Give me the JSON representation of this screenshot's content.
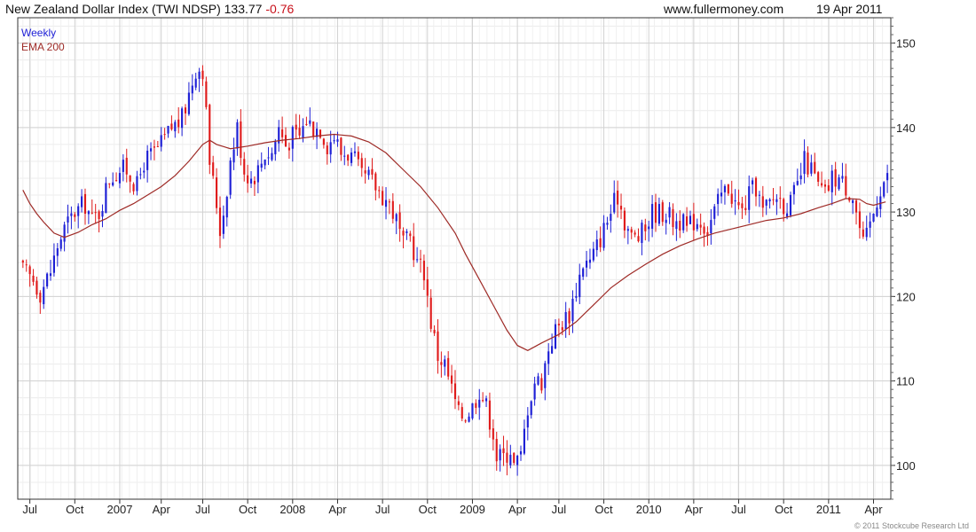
{
  "header": {
    "title": "New Zealand Dollar Index (TWI NDSP)",
    "last": "133.77",
    "change": "-0.76",
    "site": "www.fullermoney.com",
    "date": "19 Apr 2011"
  },
  "footer": {
    "copyright": "© 2011 Stockcube Research Ltd"
  },
  "colors": {
    "up": "#1d1fd6",
    "down": "#e01b1b",
    "ema": "#9e2a26",
    "grid": "#d2d2d2",
    "axis": "#333333"
  },
  "chart_data": {
    "type": "candlestick",
    "frequency": "Weekly",
    "legend": [
      "Weekly",
      "EMA 200"
    ],
    "ylim": [
      96,
      153
    ],
    "y_ticks": [
      100,
      110,
      120,
      130,
      140,
      150
    ],
    "x_ticks": [
      {
        "label": "Jul",
        "t": 2
      },
      {
        "label": "Oct",
        "t": 15
      },
      {
        "label": "2007",
        "t": 28
      },
      {
        "label": "Apr",
        "t": 40
      },
      {
        "label": "Jul",
        "t": 52
      },
      {
        "label": "Oct",
        "t": 65
      },
      {
        "label": "2008",
        "t": 78
      },
      {
        "label": "Apr",
        "t": 91
      },
      {
        "label": "Jul",
        "t": 104
      },
      {
        "label": "Oct",
        "t": 117
      },
      {
        "label": "2009",
        "t": 130
      },
      {
        "label": "Apr",
        "t": 143
      },
      {
        "label": "Jul",
        "t": 155
      },
      {
        "label": "Oct",
        "t": 168
      },
      {
        "label": "2010",
        "t": 181
      },
      {
        "label": "Apr",
        "t": 194
      },
      {
        "label": "Jul",
        "t": 207
      },
      {
        "label": "Oct",
        "t": 220
      },
      {
        "label": "2011",
        "t": 233
      },
      {
        "label": "Apr",
        "t": 246
      }
    ],
    "close_path": [
      [
        0,
        123
      ],
      [
        3,
        122
      ],
      [
        5,
        120.5
      ],
      [
        8,
        123
      ],
      [
        10,
        126
      ],
      [
        12,
        128
      ],
      [
        15,
        130
      ],
      [
        18,
        131
      ],
      [
        20,
        129
      ],
      [
        22,
        130
      ],
      [
        25,
        134
      ],
      [
        28,
        135
      ],
      [
        30,
        135
      ],
      [
        33,
        133
      ],
      [
        35,
        136
      ],
      [
        38,
        137
      ],
      [
        40,
        138
      ],
      [
        43,
        140
      ],
      [
        46,
        141
      ],
      [
        48,
        144
      ],
      [
        50,
        147
      ],
      [
        52,
        147
      ],
      [
        54,
        136
      ],
      [
        56,
        131
      ],
      [
        57,
        128
      ],
      [
        58,
        130
      ],
      [
        60,
        136
      ],
      [
        62,
        140
      ],
      [
        64,
        135
      ],
      [
        66,
        134
      ],
      [
        68,
        135
      ],
      [
        70,
        137
      ],
      [
        72,
        137
      ],
      [
        74,
        140
      ],
      [
        76,
        138
      ],
      [
        78,
        139
      ],
      [
        80,
        139
      ],
      [
        82,
        141
      ],
      [
        84,
        140
      ],
      [
        86,
        140
      ],
      [
        88,
        138
      ],
      [
        90,
        139
      ],
      [
        92,
        137
      ],
      [
        94,
        137
      ],
      [
        96,
        136
      ],
      [
        98,
        134
      ],
      [
        100,
        134
      ],
      [
        102,
        133
      ],
      [
        104,
        132
      ],
      [
        106,
        131
      ],
      [
        108,
        129
      ],
      [
        110,
        126
      ],
      [
        112,
        127
      ],
      [
        114,
        124
      ],
      [
        116,
        123
      ],
      [
        118,
        117
      ],
      [
        120,
        113
      ],
      [
        122,
        112
      ],
      [
        124,
        109
      ],
      [
        126,
        106
      ],
      [
        128,
        106
      ],
      [
        130,
        107
      ],
      [
        132,
        109
      ],
      [
        134,
        107
      ],
      [
        136,
        104
      ],
      [
        137,
        101
      ],
      [
        139,
        101
      ],
      [
        141,
        102
      ],
      [
        142,
        100
      ],
      [
        144,
        101
      ],
      [
        146,
        107
      ],
      [
        148,
        110
      ],
      [
        150,
        110
      ],
      [
        152,
        114
      ],
      [
        154,
        116
      ],
      [
        156,
        117
      ],
      [
        158,
        118
      ],
      [
        160,
        121
      ],
      [
        162,
        124
      ],
      [
        164,
        124
      ],
      [
        166,
        126
      ],
      [
        168,
        128
      ],
      [
        170,
        130
      ],
      [
        172,
        132
      ],
      [
        174,
        129
      ],
      [
        176,
        127
      ],
      [
        178,
        127
      ],
      [
        180,
        128
      ],
      [
        182,
        130
      ],
      [
        184,
        130
      ],
      [
        186,
        130
      ],
      [
        188,
        129
      ],
      [
        190,
        129
      ],
      [
        192,
        128
      ],
      [
        194,
        129
      ],
      [
        196,
        129
      ],
      [
        198,
        128
      ],
      [
        200,
        130
      ],
      [
        202,
        132
      ],
      [
        204,
        133
      ],
      [
        206,
        131
      ],
      [
        208,
        130
      ],
      [
        210,
        132
      ],
      [
        212,
        133
      ],
      [
        214,
        130
      ],
      [
        216,
        131
      ],
      [
        218,
        132
      ],
      [
        220,
        131
      ],
      [
        222,
        131
      ],
      [
        224,
        133
      ],
      [
        226,
        136
      ],
      [
        228,
        135
      ],
      [
        230,
        133
      ],
      [
        232,
        132
      ],
      [
        234,
        134
      ],
      [
        236,
        134
      ],
      [
        238,
        133
      ],
      [
        240,
        132
      ],
      [
        242,
        128
      ],
      [
        243,
        126
      ],
      [
        244,
        127
      ],
      [
        246,
        130
      ],
      [
        248,
        133
      ],
      [
        249.5,
        134
      ]
    ],
    "ema200": [
      [
        0,
        132.6
      ],
      [
        2,
        131
      ],
      [
        4,
        129.8
      ],
      [
        6,
        128.8
      ],
      [
        9,
        127.5
      ],
      [
        12,
        127
      ],
      [
        16,
        127.6
      ],
      [
        20,
        128.5
      ],
      [
        24,
        129.2
      ],
      [
        28,
        130.2
      ],
      [
        32,
        131
      ],
      [
        36,
        132
      ],
      [
        40,
        133
      ],
      [
        44,
        134.3
      ],
      [
        48,
        136
      ],
      [
        50,
        137
      ],
      [
        52,
        138
      ],
      [
        54,
        138.5
      ],
      [
        56,
        138
      ],
      [
        60,
        137.5
      ],
      [
        65,
        137.8
      ],
      [
        70,
        138.2
      ],
      [
        75,
        138.5
      ],
      [
        80,
        138.7
      ],
      [
        85,
        139
      ],
      [
        90,
        139.2
      ],
      [
        95,
        139
      ],
      [
        100,
        138.3
      ],
      [
        105,
        137
      ],
      [
        110,
        135
      ],
      [
        115,
        133
      ],
      [
        120,
        130.5
      ],
      [
        125,
        127.5
      ],
      [
        128,
        125
      ],
      [
        132,
        122
      ],
      [
        136,
        119
      ],
      [
        140,
        116
      ],
      [
        143,
        114.2
      ],
      [
        146,
        113.6
      ],
      [
        150,
        114.5
      ],
      [
        155,
        115.5
      ],
      [
        160,
        117
      ],
      [
        165,
        119
      ],
      [
        170,
        121
      ],
      [
        175,
        122.5
      ],
      [
        180,
        123.8
      ],
      [
        185,
        125
      ],
      [
        190,
        126
      ],
      [
        195,
        126.8
      ],
      [
        200,
        127.5
      ],
      [
        205,
        128
      ],
      [
        210,
        128.5
      ],
      [
        215,
        129
      ],
      [
        220,
        129.3
      ],
      [
        225,
        129.8
      ],
      [
        230,
        130.5
      ],
      [
        234,
        131
      ],
      [
        238,
        131.6
      ],
      [
        242,
        131.5
      ],
      [
        244,
        131
      ],
      [
        246,
        130.8
      ],
      [
        249.5,
        131.2
      ]
    ]
  }
}
